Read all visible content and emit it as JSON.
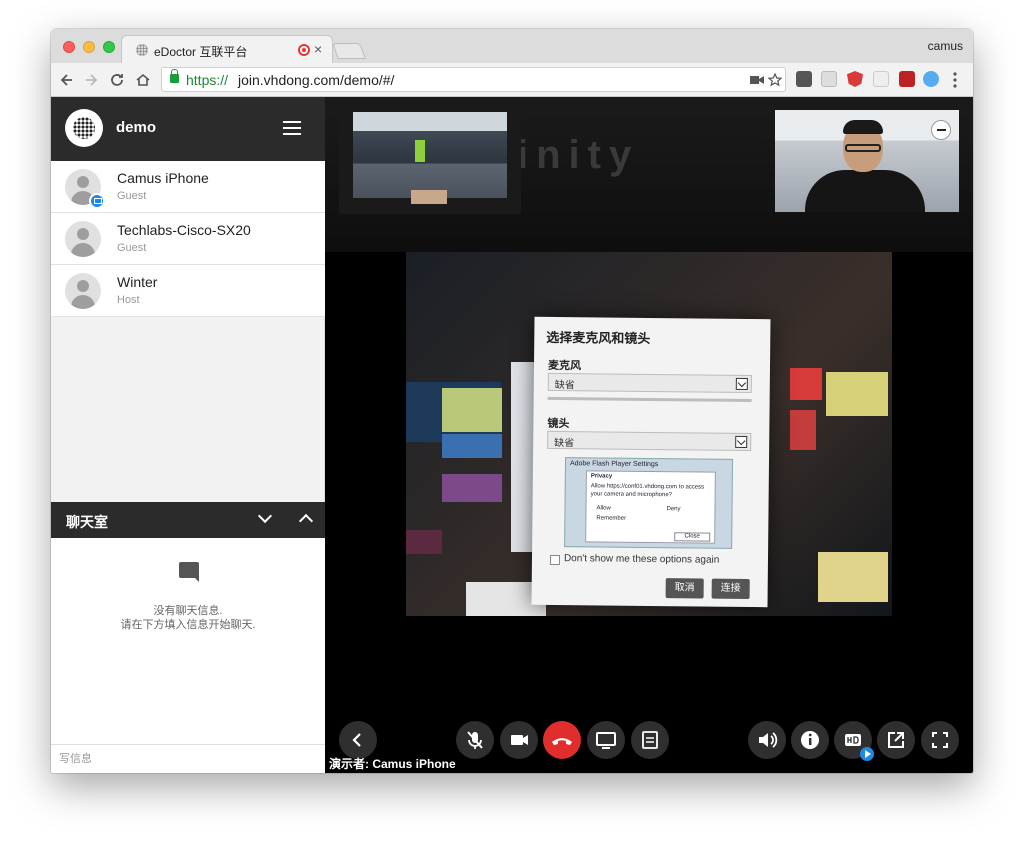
{
  "browser": {
    "tab_title": "eDoctor 互联平台",
    "tab_close": "×",
    "user": "camus",
    "url_scheme": "https://",
    "url_rest": "join.vhdong.com/demo/#/",
    "extension_icons": [
      "pocket-icon",
      "lock-ext-icon",
      "angular-icon",
      "fonts-icon",
      "badge-ext-icon",
      "twitter-ext-icon"
    ]
  },
  "sidebar": {
    "room_name": "demo",
    "participants": [
      {
        "name": "Camus iPhone",
        "role": "Guest",
        "presenting": true
      },
      {
        "name": "Techlabs-Cisco-SX20",
        "role": "Guest",
        "presenting": false
      },
      {
        "name": "Winter",
        "role": "Host",
        "presenting": false
      }
    ],
    "chat_title": "聊天室",
    "chat_empty_line1": "没有聊天信息.",
    "chat_empty_line2": "请在下方填入信息开始聊天.",
    "chat_placeholder": "写信息"
  },
  "stage": {
    "brand_text": "inity",
    "presenter_label": "演示者: Camus iPhone",
    "dialog": {
      "title": "选择麦克风和镜头",
      "mic_label": "麦克风",
      "mic_value": "缺省",
      "cam_label": "镜头",
      "cam_value": "缺省",
      "flash_title": "Adobe Flash Player Settings",
      "flash_privacy": "Privacy",
      "flash_allow_text": "Allow https://conf01.vhdong.com to access",
      "flash_allow_text2": "your camera and microphone?",
      "flash_allow": "Allow",
      "flash_deny": "Deny",
      "flash_remember": "Remember",
      "flash_close": "Close",
      "dont_show": "Don't show me these options again",
      "cancel": "取消",
      "connect": "连接"
    }
  },
  "colors": {
    "hangup": "#e02d2d",
    "accent": "#1e88e5",
    "header_dark": "#2b2b2b"
  }
}
